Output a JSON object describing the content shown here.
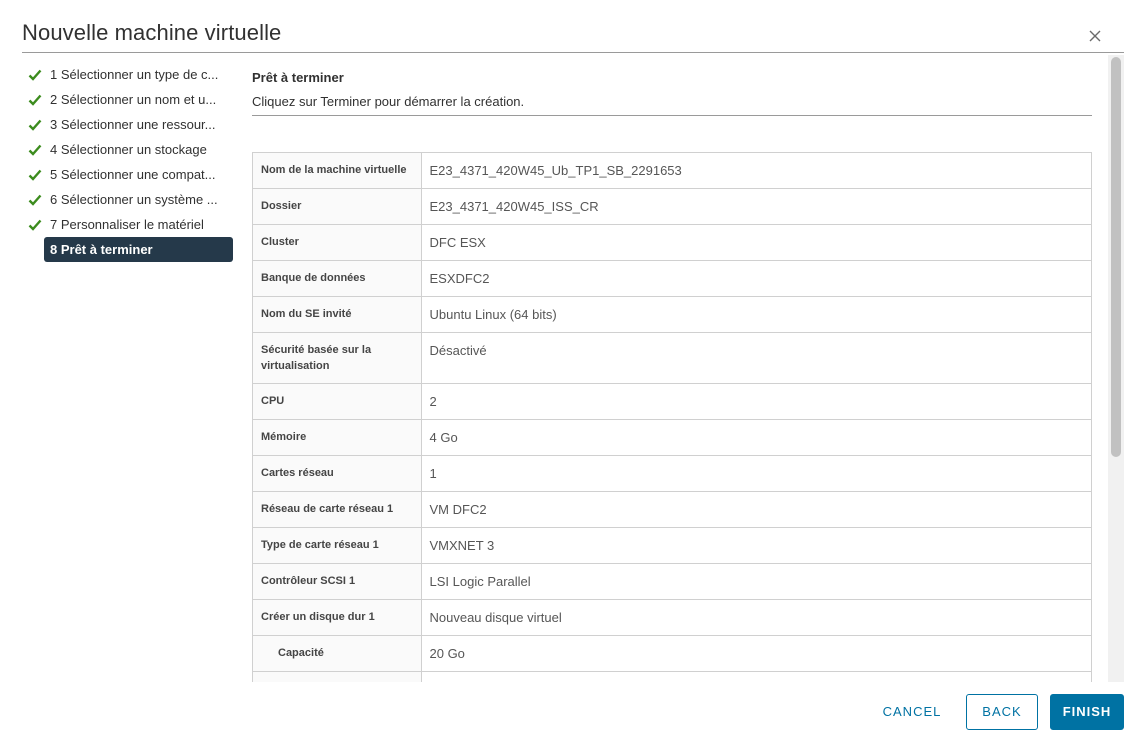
{
  "dialog": {
    "title": "Nouvelle machine virtuelle",
    "close_icon": "close-icon"
  },
  "steps": [
    {
      "label": "1 Sélectionner un type de c...",
      "done": true
    },
    {
      "label": "2 Sélectionner un nom et u...",
      "done": true
    },
    {
      "label": "3 Sélectionner une ressour...",
      "done": true
    },
    {
      "label": "4 Sélectionner un stockage",
      "done": true
    },
    {
      "label": "5 Sélectionner une compat...",
      "done": true
    },
    {
      "label": "6 Sélectionner un système ...",
      "done": true
    },
    {
      "label": "7 Personnaliser le matériel",
      "done": true
    },
    {
      "label": "8 Prêt à terminer",
      "done": false,
      "active": true
    }
  ],
  "content": {
    "title": "Prêt à terminer",
    "description": "Cliquez sur Terminer pour démarrer la création."
  },
  "summary": [
    {
      "key": "Nom de la machine virtuelle",
      "value": "E23_4371_420W45_Ub_TP1_SB_2291653"
    },
    {
      "key": "Dossier",
      "value": "E23_4371_420W45_ISS_CR"
    },
    {
      "key": "Cluster",
      "value": "DFC ESX"
    },
    {
      "key": "Banque de données",
      "value": "ESXDFC2"
    },
    {
      "key": "Nom du SE invité",
      "value": "Ubuntu Linux (64 bits)"
    },
    {
      "key": "Sécurité basée sur la virtualisation",
      "value": "Désactivé"
    },
    {
      "key": "CPU",
      "value": "2"
    },
    {
      "key": "Mémoire",
      "value": "4 Go"
    },
    {
      "key": "Cartes réseau",
      "value": "1"
    },
    {
      "key": "Réseau de carte réseau 1",
      "value": "VM DFC2"
    },
    {
      "key": "Type de carte réseau 1",
      "value": "VMXNET 3"
    },
    {
      "key": "Contrôleur SCSI 1",
      "value": "LSI Logic Parallel"
    },
    {
      "key": "Créer un disque dur 1",
      "value": "Nouveau disque virtuel"
    },
    {
      "key": "Capacité",
      "value": "20 Go",
      "indent": true
    },
    {
      "key": "",
      "value": ""
    }
  ],
  "footer": {
    "cancel": "CANCEL",
    "back": "BACK",
    "finish": "FINISH"
  },
  "colors": {
    "accent": "#0072a3",
    "active_step_bg": "#25394a",
    "check": "#3c8c1e"
  }
}
